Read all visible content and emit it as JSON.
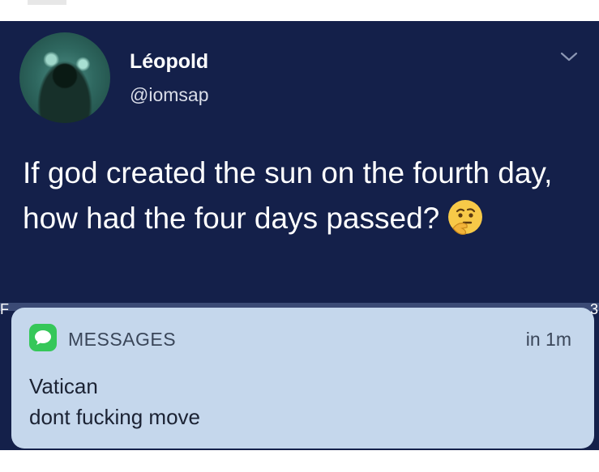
{
  "tweet": {
    "author_name": "Léopold",
    "author_handle": "@iomsap",
    "text": "If god created the sun on the fourth day, how had the four days passed?",
    "emoji": "thinking-face"
  },
  "notification": {
    "app_name": "MESSAGES",
    "time": "in 1m",
    "sender": "Vatican",
    "message": "dont fucking move",
    "icon": "messages-icon",
    "accent_color": "#35c759"
  },
  "colors": {
    "tweet_background": "#14204a",
    "notification_background": "#c5d7ec"
  }
}
